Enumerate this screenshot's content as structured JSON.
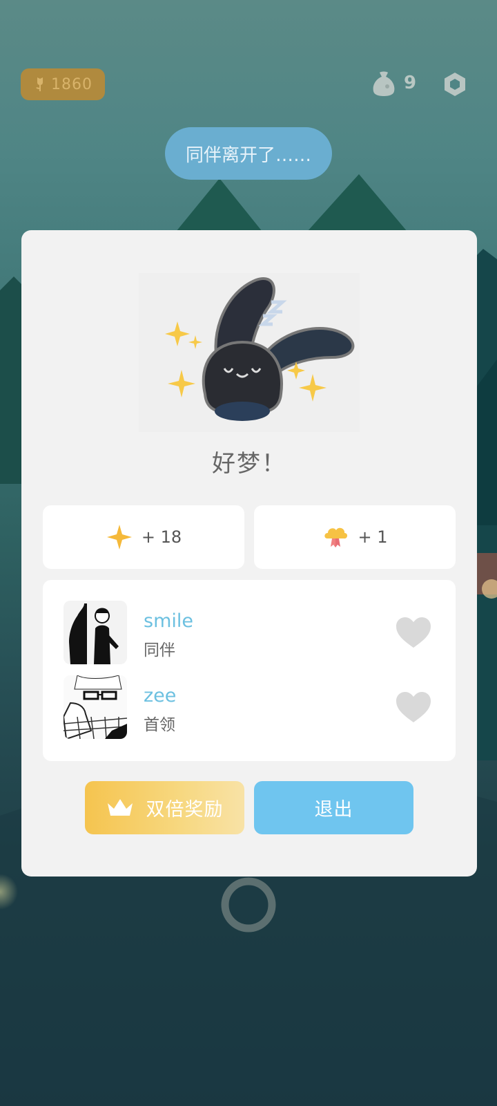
{
  "top_bar": {
    "currency_value": "1860",
    "currency_icon": "tulip-icon",
    "bag_count": "9",
    "bag_icon": "sack-icon",
    "settings_icon": "hexagon-settings-icon"
  },
  "toast": {
    "text": "同伴离开了……"
  },
  "dialog": {
    "illustration": "sleeping-bunny-with-sparkles",
    "title": "好梦！",
    "rewards": [
      {
        "icon": "sparkle-icon",
        "amount": "+ 18"
      },
      {
        "icon": "cloud-badge-icon",
        "amount": "+ 1"
      }
    ],
    "members": [
      {
        "name": "smile",
        "role": "同伴"
      },
      {
        "name": "zee",
        "role": "首领"
      }
    ],
    "double_reward_label": "双倍奖励",
    "exit_label": "退出"
  },
  "colors": {
    "accent_blue": "#6fc5ef",
    "accent_gold": "#f5c44f",
    "name_blue": "#6cc0e0",
    "card_bg": "#f2f2f2"
  }
}
